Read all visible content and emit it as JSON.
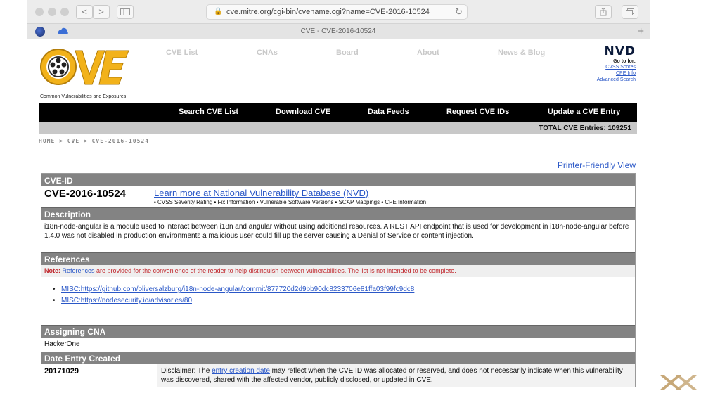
{
  "browser": {
    "url": "cve.mitre.org/cgi-bin/cvename.cgi?name=CVE-2016-10524",
    "tab_title": "CVE - CVE-2016-10524",
    "back": "<",
    "forward": ">",
    "plus": "+"
  },
  "site": {
    "logo_text": "CVE",
    "logo_tagline": "Common Vulnerabilities and Exposures",
    "topnav": [
      "CVE List",
      "CNAs",
      "Board",
      "About",
      "News & Blog"
    ],
    "nvd": {
      "logo": "NVD",
      "goto": "Go to for:",
      "links": [
        "CVSS Scores",
        "CPE Info",
        "Advanced Search"
      ]
    },
    "mainnav": [
      "Search CVE List",
      "Download CVE",
      "Data Feeds",
      "Request CVE IDs",
      "Update a CVE Entry"
    ],
    "total_label": "TOTAL CVE Entries:",
    "total_value": "109251",
    "breadcrumb": "HOME > CVE > CVE-2016-10524",
    "printer_link": "Printer-Friendly View"
  },
  "cve": {
    "id_header": "CVE-ID",
    "id": "CVE-2016-10524",
    "nvd_link": "Learn more at National Vulnerability Database (NVD)",
    "nvd_sub": "• CVSS Severity Rating • Fix Information • Vulnerable Software Versions • SCAP Mappings • CPE Information",
    "description_header": "Description",
    "description": "i18n-node-angular is a module used to interact between i18n and angular without using additional resources. A REST API endpoint that is used for development in i18n-node-angular before 1.4.0 was not disabled in production environments a malicious user could fill up the server causing a Denial of Service or content injection.",
    "references_header": "References",
    "note_label": "Note:",
    "note_link": "References",
    "note_text": " are provided for the convenience of the reader to help distinguish between vulnerabilities. The list is not intended to be complete.",
    "references": [
      "MISC:https://github.com/oliversalzburg/i18n-node-angular/commit/877720d2d9bb90dc8233706e81ffa03f99fc9dc8",
      "MISC:https://nodesecurity.io/advisories/80"
    ],
    "cna_header": "Assigning CNA",
    "cna": "HackerOne",
    "date_header": "Date Entry Created",
    "date": "20171029",
    "disclaimer_pre": "Disclaimer: The ",
    "disclaimer_link": "entry creation date",
    "disclaimer_post": " may reflect when the CVE ID was allocated or reserved, and does not necessarily indicate when this vulnerability was discovered, shared with the affected vendor, publicly disclosed, or updated in CVE."
  },
  "colors": {
    "link": "#2a57c7",
    "header_gray": "#838383",
    "note_red": "#c0272d",
    "logo_gold": "#f2b21a"
  }
}
